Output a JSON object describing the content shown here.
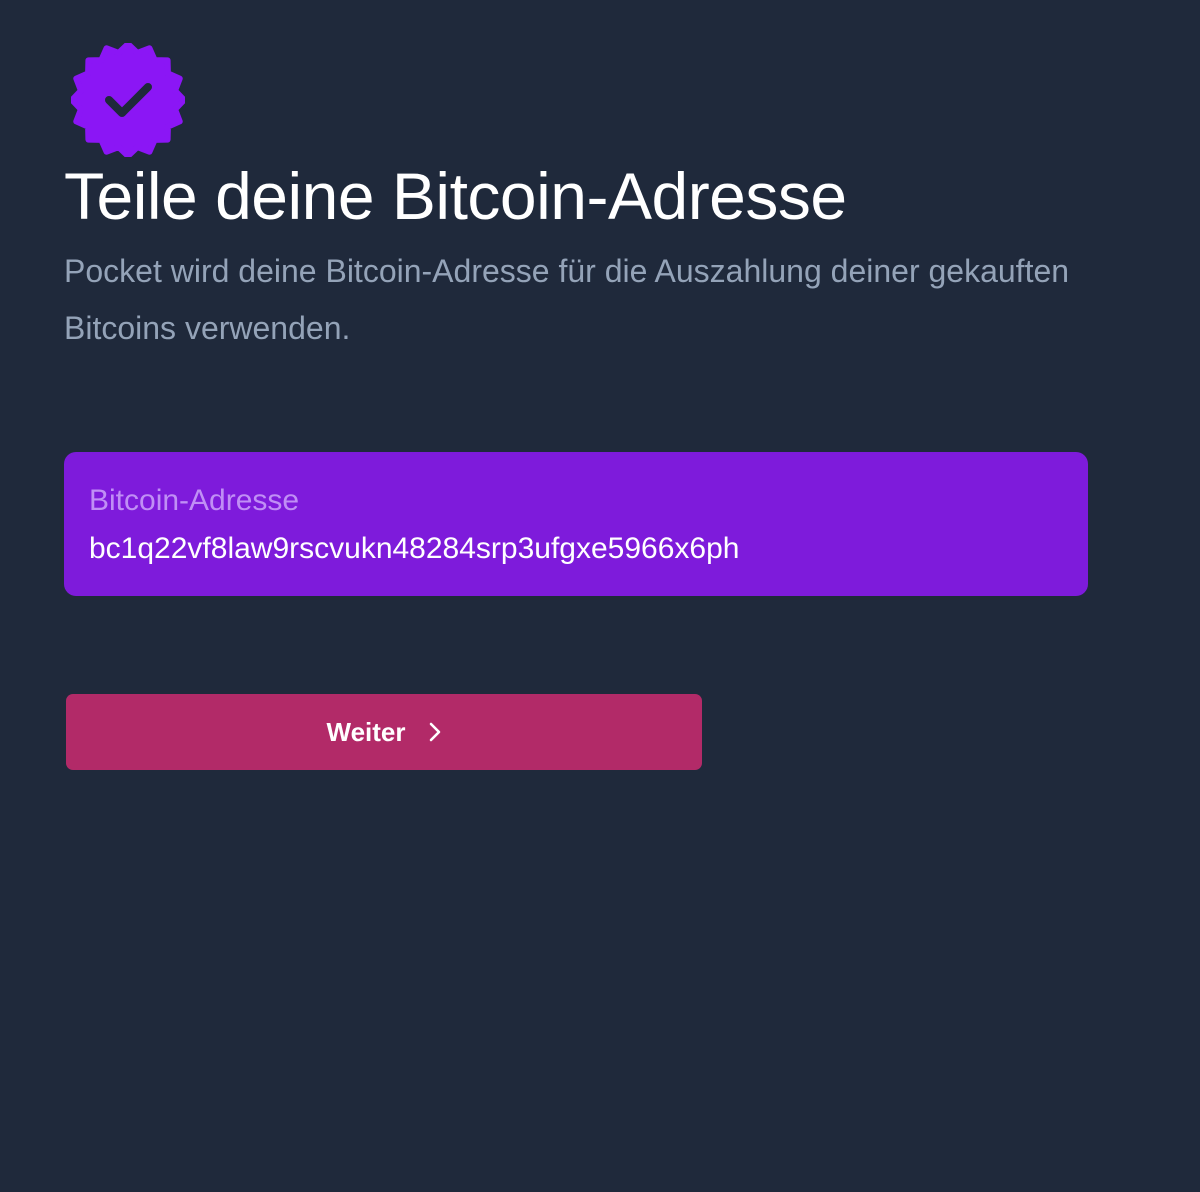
{
  "badge": {
    "icon": "verified-badge-icon",
    "color": "#8b16f5"
  },
  "header": {
    "title": "Teile deine Bitcoin-Adresse",
    "subtitle": "Pocket wird deine Bitcoin-Adresse für die Auszahlung deiner gekauften Bitcoins verwenden."
  },
  "address_field": {
    "label": "Bitcoin-Adresse",
    "value": "bc1q22vf8law9rscvukn48284srp3ufgxe5966x6ph",
    "background": "#7e1bdb"
  },
  "continue_button": {
    "label": "Weiter",
    "icon": "chevron-right-icon",
    "background": "#b22a68"
  },
  "colors": {
    "page_background": "#1f293b",
    "subtitle_text": "#94a3b8",
    "field_label_text": "#c08ff5"
  }
}
